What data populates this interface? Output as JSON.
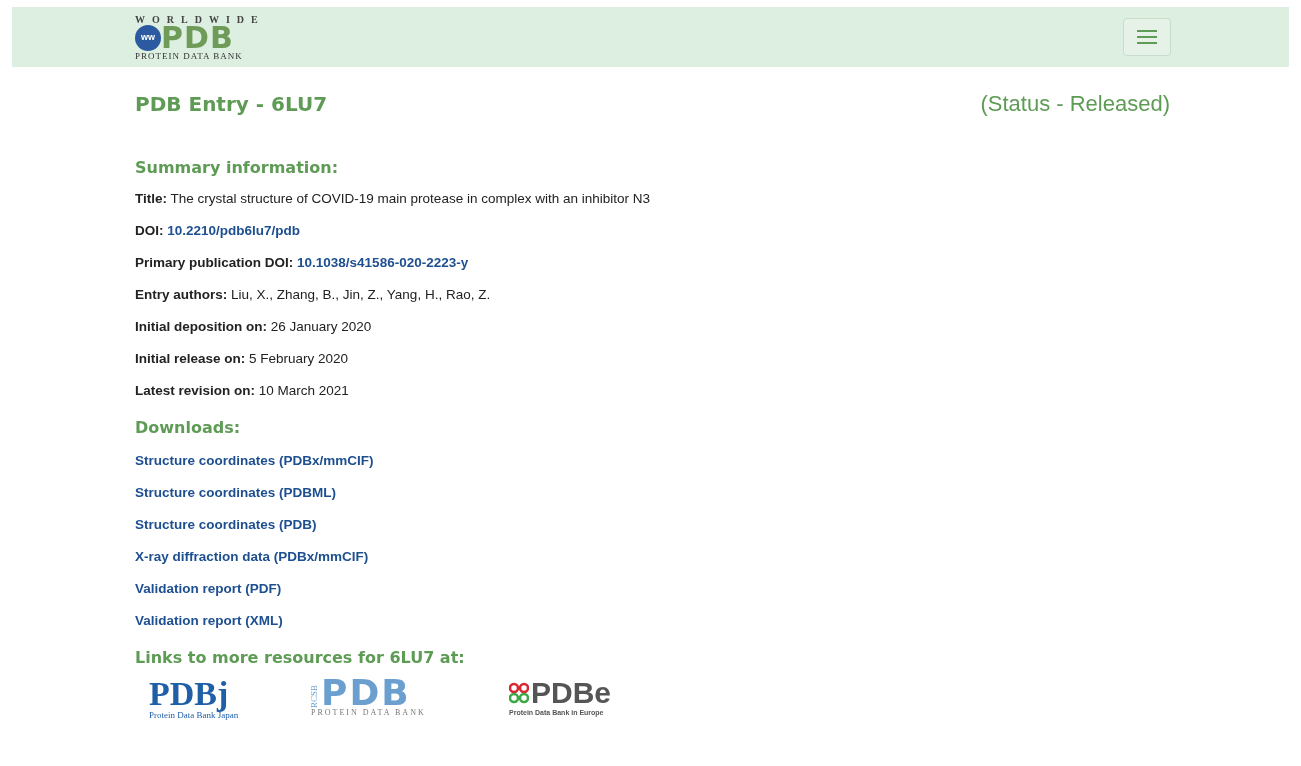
{
  "header": {
    "logo": {
      "top": "WORLDWIDE",
      "main": "PDB",
      "badge": "ww",
      "bottom": "PROTEIN DATA BANK"
    },
    "menu_button": {
      "expanded": false
    }
  },
  "entry_title": "PDB Entry - 6LU7",
  "status": "(Status - Released)",
  "summary": {
    "heading": "Summary information:",
    "fields": [
      {
        "label": "Title:",
        "value": "The crystal structure of COVID-19 main protease in complex with an inhibitor N3",
        "kind": "text"
      },
      {
        "label": "DOI:",
        "value": "10.2210/pdb6lu7/pdb",
        "kind": "link"
      },
      {
        "label": "Primary publication DOI:",
        "value": "10.1038/s41586-020-2223-y",
        "kind": "link"
      },
      {
        "label": "Entry authors:",
        "value": "Liu, X., Zhang, B., Jin, Z., Yang, H., Rao, Z.",
        "kind": "text"
      },
      {
        "label": "Initial deposition on:",
        "value": "26 January 2020",
        "kind": "text"
      },
      {
        "label": "Initial release on:",
        "value": "5 February 2020",
        "kind": "text"
      },
      {
        "label": "Latest revision on:",
        "value": "10 March 2021",
        "kind": "text"
      }
    ]
  },
  "downloads": {
    "heading": "Downloads:",
    "links": [
      "Structure coordinates (PDBx/mmCIF)",
      "Structure coordinates (PDBML)",
      "Structure coordinates (PDB)",
      "X-ray diffraction data (PDBx/mmCIF)",
      "Validation report (PDF)",
      "Validation report (XML)"
    ]
  },
  "resources": {
    "heading": "Links to more resources for 6LU7 at:",
    "logos": [
      {
        "kind": "pdbj",
        "main": "PDBj",
        "caption": "Protein Data Bank Japan"
      },
      {
        "kind": "rcsb",
        "side": "RCSB",
        "main": "PDB",
        "caption": "PROTEIN DATA BANK"
      },
      {
        "kind": "pdbe",
        "main": "PDBe",
        "caption": "Protein Data Bank in Europe"
      }
    ]
  }
}
